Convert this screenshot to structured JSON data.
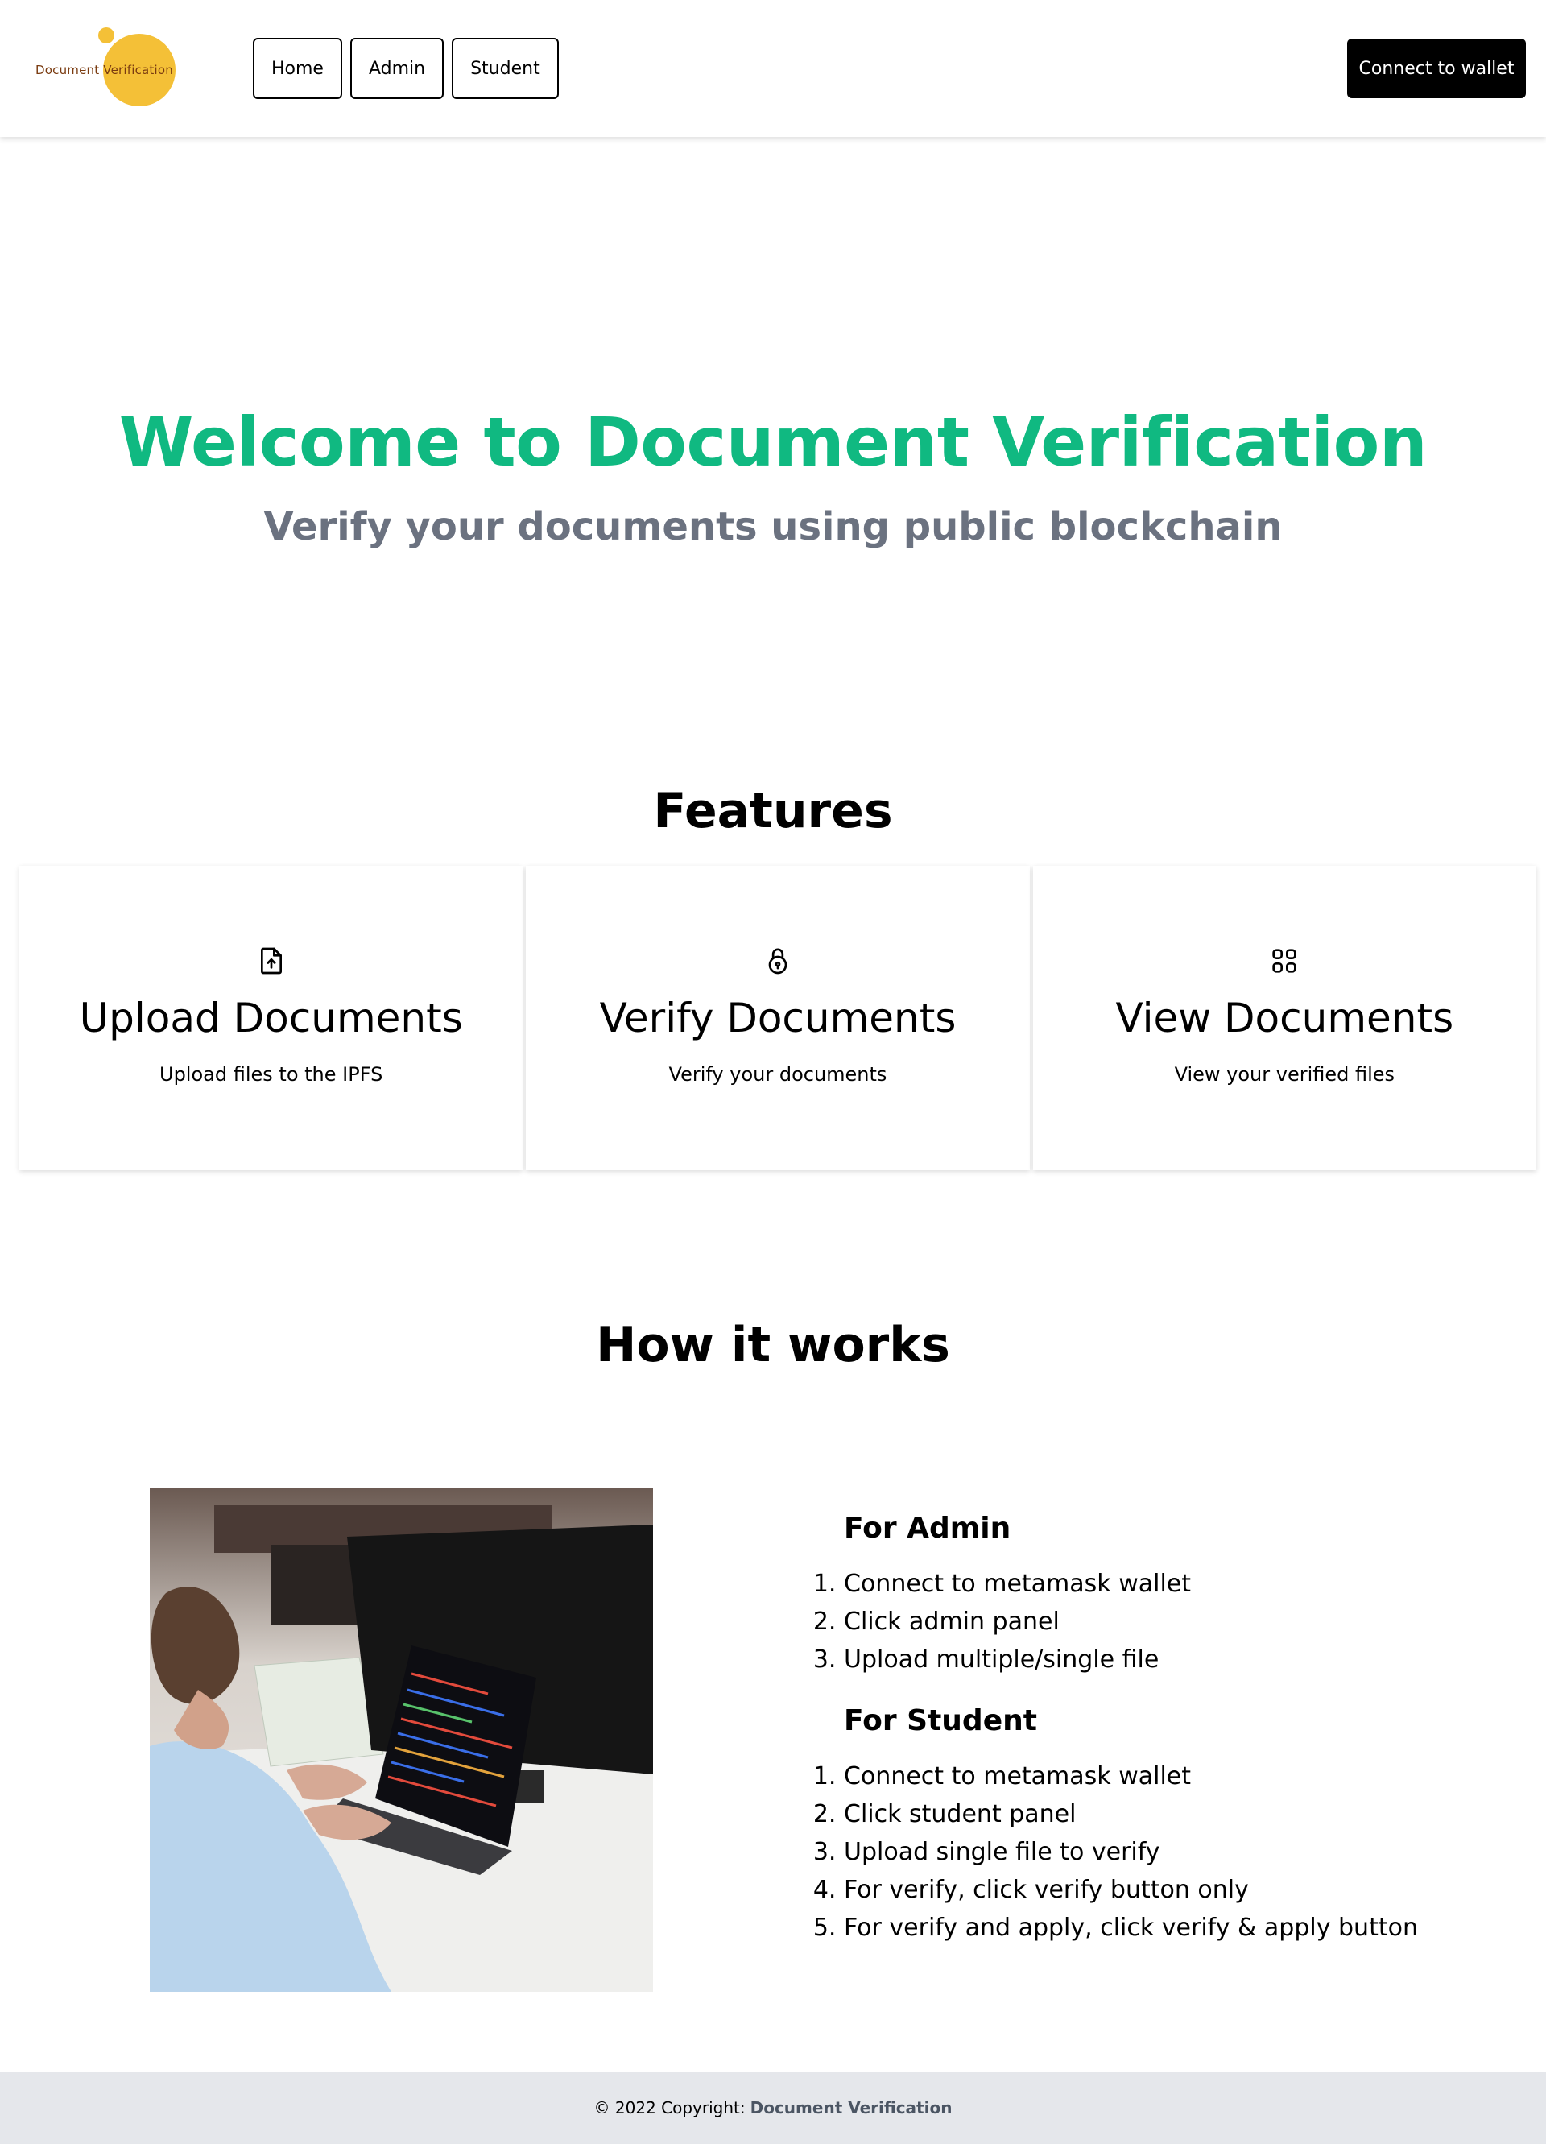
{
  "navbar": {
    "logo_text": "Document Verification",
    "links": [
      {
        "label": "Home"
      },
      {
        "label": "Admin"
      },
      {
        "label": "Student"
      }
    ],
    "connect_label": "Connect to wallet"
  },
  "hero": {
    "title": "Welcome to Document Verification",
    "subtitle": "Verify your documents using public blockchain"
  },
  "features": {
    "title": "Features",
    "cards": [
      {
        "icon": "file-upload-icon",
        "title": "Upload Documents",
        "description": "Upload files to the IPFS"
      },
      {
        "icon": "lock-icon",
        "title": "Verify Documents",
        "description": "Verify your documents"
      },
      {
        "icon": "grid-icon",
        "title": "View Documents",
        "description": "View your verified files"
      }
    ]
  },
  "how_it_works": {
    "title": "How it works",
    "image": "person-typing-code-on-laptop",
    "admin": {
      "heading": "For Admin",
      "steps": [
        "Connect to metamask wallet",
        "Click admin panel",
        "Upload multiple/single file"
      ]
    },
    "student": {
      "heading": "For Student",
      "steps": [
        "Connect to metamask wallet",
        "Click student panel",
        "Upload single file to verify",
        "For verify, click verify button only",
        "For verify and apply, click verify & apply button"
      ]
    }
  },
  "footer": {
    "copyright": "© 2022 Copyright:",
    "brand": "Document Verification"
  },
  "colors": {
    "accent_green": "#10b981",
    "subtitle_gray": "#6b7280",
    "logo_yellow": "#f4c037",
    "footer_bg": "#e5e7eb"
  }
}
